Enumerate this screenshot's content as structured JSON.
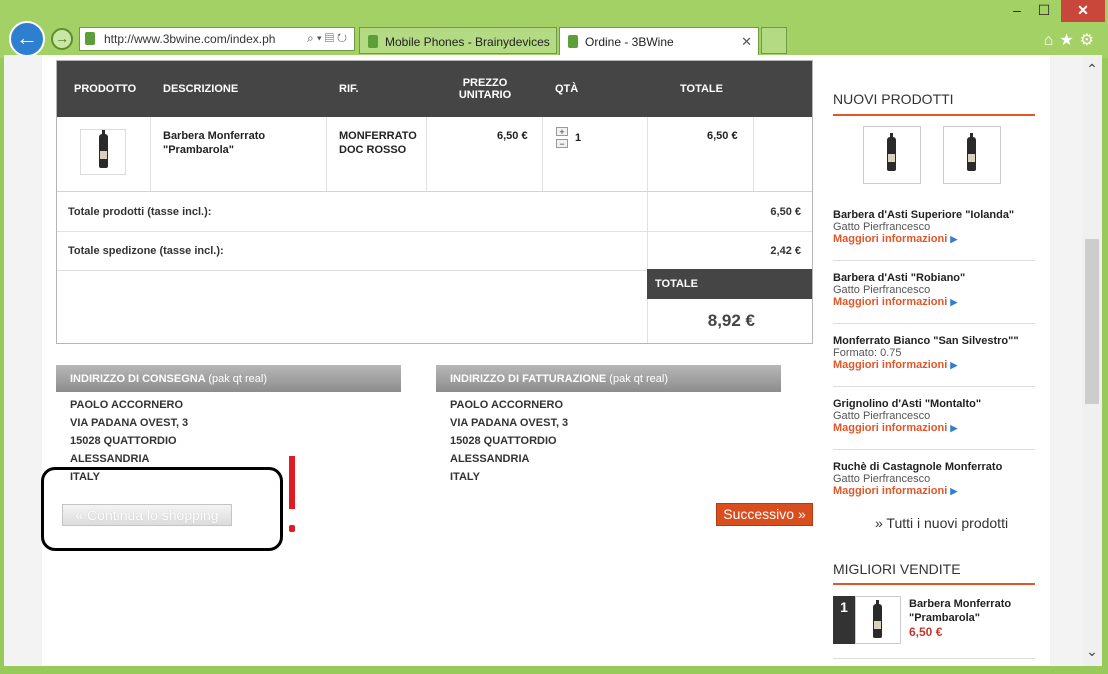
{
  "browser": {
    "url": "http://www.3bwine.com/index.ph",
    "tabs": [
      {
        "label": "Mobile Phones - Brainydevices"
      },
      {
        "label": "Ordine - 3BWine"
      }
    ],
    "window_controls": {
      "minimize": "–",
      "maximize": "☐",
      "close": "✕"
    }
  },
  "cart": {
    "headers": {
      "product": "PRODOTTO",
      "description": "DESCRIZIONE",
      "ref": "RIF.",
      "unit_price": "PREZZO UNITARIO",
      "qty": "QTÀ",
      "total": "TOTALE"
    },
    "item": {
      "description": "Barbera Monferrato \"Prambarola\"",
      "ref": "MONFERRATO DOC ROSSO",
      "unit_price": "6,50 €",
      "qty": "1",
      "total": "6,50 €"
    },
    "totals": {
      "products_label": "Totale prodotti (tasse incl.):",
      "products_value": "6,50 €",
      "shipping_label": "Totale spedizone (tasse incl.):",
      "shipping_value": "2,42 €",
      "total_label": "TOTALE",
      "total_value": "8,92 €"
    }
  },
  "addresses": {
    "delivery": {
      "title": "INDIRIZZO DI CONSEGNA",
      "subtitle": "(pak qt real)",
      "lines": [
        "PAOLO ACCORNERO",
        "VIA PADANA OVEST, 3",
        "15028 QUATTORDIO",
        "ALESSANDRIA",
        "ITALY"
      ]
    },
    "billing": {
      "title": "INDIRIZZO DI FATTURAZIONE",
      "subtitle": "(pak qt real)",
      "lines": [
        "PAOLO ACCORNERO",
        "VIA PADANA OVEST, 3",
        "15028 QUATTORDIO",
        "ALESSANDRIA",
        "ITALY"
      ]
    }
  },
  "buttons": {
    "continue": "« Continua lo shopping",
    "next": "Successivo »"
  },
  "sidebar": {
    "new_products_title": "NUOVI PRODOTTI",
    "items": [
      {
        "name": "Barbera d'Asti Superiore \"Iolanda\"",
        "sub": "Gatto Pierfrancesco",
        "more": "Maggiori informazioni"
      },
      {
        "name": "Barbera d'Asti \"Robiano\"",
        "sub": "Gatto Pierfrancesco",
        "more": "Maggiori informazioni"
      },
      {
        "name": "Monferrato Bianco \"San Silvestro\"\"",
        "sub": "Formato: 0.75",
        "more": "Maggiori informazioni"
      },
      {
        "name": "Grignolino d'Asti \"Montalto\"",
        "sub": "Gatto Pierfrancesco",
        "more": "Maggiori informazioni"
      },
      {
        "name": "Ruchè di Castagnole Monferrato",
        "sub": "Gatto Pierfrancesco",
        "more": "Maggiori informazioni"
      }
    ],
    "all_new": "» Tutti i nuovi prodotti",
    "best_title": "MIGLIORI VENDITE",
    "best": {
      "rank": "1",
      "name": "Barbera Monferrato \"Prambarola\"",
      "price": "6,50 €"
    }
  }
}
